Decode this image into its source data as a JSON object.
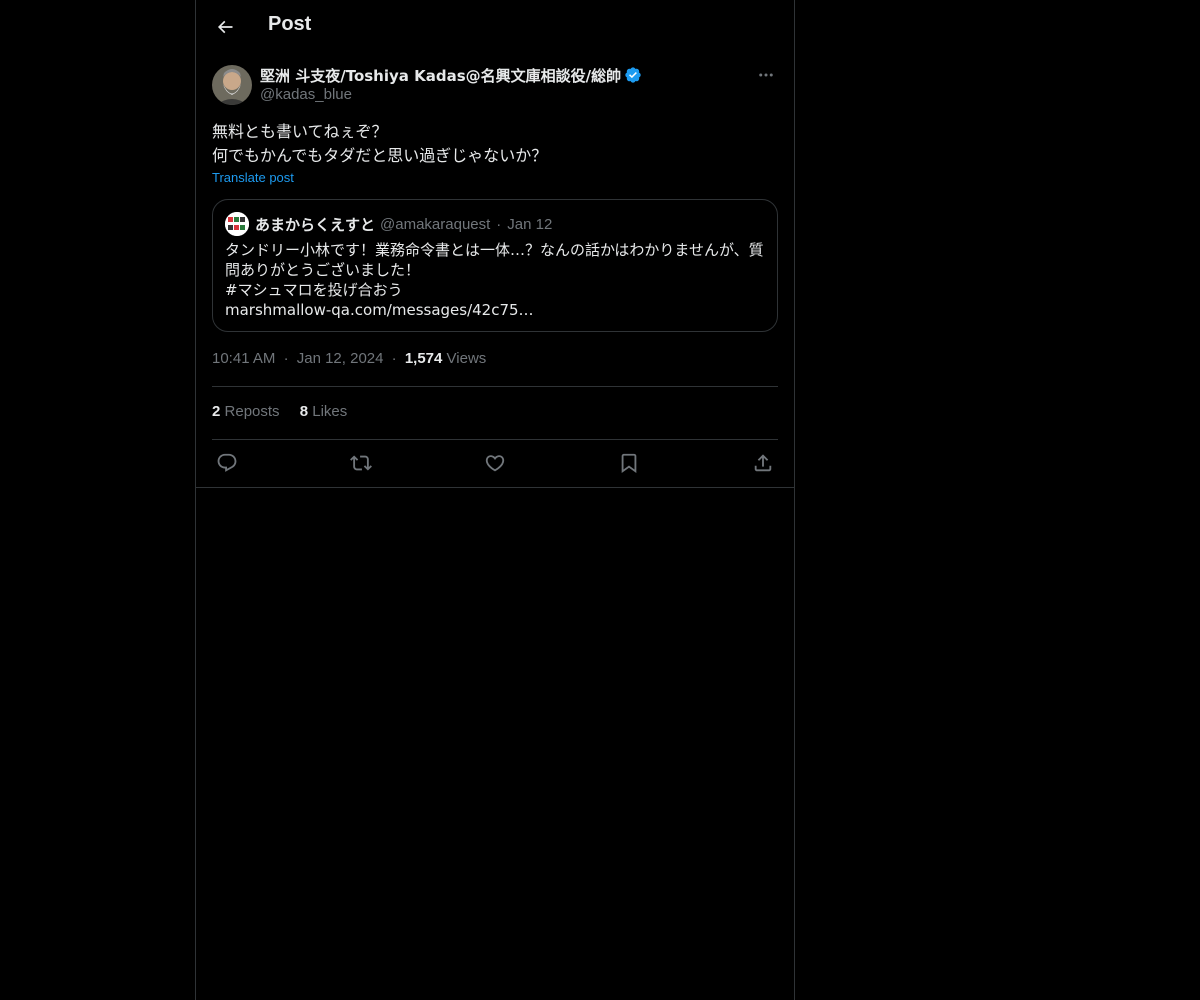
{
  "header": {
    "title": "Post"
  },
  "post": {
    "author_name": "堅洲 斗支夜/Toshiya Kadas@名興文庫相談役/総帥",
    "handle": "@kadas_blue",
    "text_lines": [
      "無料とも書いてねぇぞ？",
      "何でもかんでもタダだと思い過ぎじゃないか？"
    ],
    "translate_label": "Translate post",
    "time": "10:41 AM",
    "date": "Jan 12, 2024",
    "views_count": "1,574",
    "views_label": "Views",
    "reposts_count": "2",
    "reposts_label": "Reposts",
    "likes_count": "8",
    "likes_label": "Likes"
  },
  "quote": {
    "name": "あまからくえすと",
    "handle": "@amakaraquest",
    "date": "Jan 12",
    "lines": [
      "タンドリー小林です！業務命令書とは一体…？なんの話かはわかりませんが、質",
      "問ありがとうございました！",
      "#マシュマロを投げ合おう",
      "marshmallow-qa.com/messages/42c75…"
    ]
  },
  "separator": "·",
  "icons": {
    "back": "arrow-left-icon",
    "verified": "verified-badge-icon",
    "more": "more-icon",
    "reply": "reply-icon",
    "repost": "repost-icon",
    "like": "heart-icon",
    "bookmark": "bookmark-icon",
    "share": "share-icon"
  },
  "colors": {
    "background": "#000000",
    "accent": "#1d9bf0",
    "muted": "#71767b",
    "border": "#2f3336"
  }
}
